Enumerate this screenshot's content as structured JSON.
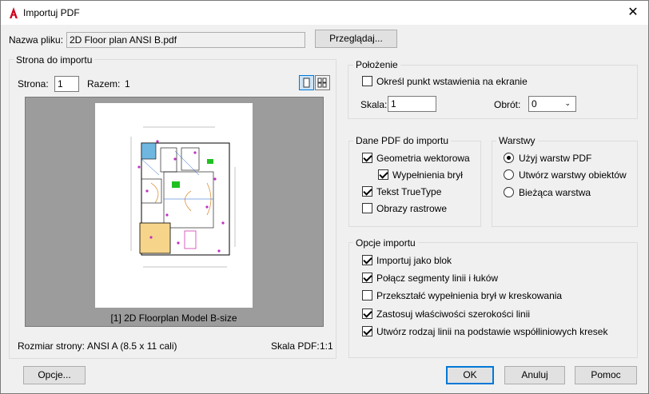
{
  "window": {
    "title": "Importuj PDF",
    "close_glyph": "✕"
  },
  "file": {
    "label": "Nazwa pliku:",
    "value": "2D Floor plan ANSI B.pdf",
    "browse_label": "Przeglądaj..."
  },
  "page_section": {
    "title": "Strona do importu",
    "page_label": "Strona:",
    "page_value": "1",
    "total_label": "Razem:",
    "total_value": "1",
    "preview_caption": "[1] 2D Floorplan Model B-size",
    "page_size_label": "Rozmiar strony:",
    "page_size_value": "ANSI A (8.5 x 11 cali)",
    "pdf_scale_label": "Skala PDF:",
    "pdf_scale_value": "1:1"
  },
  "position": {
    "title": "Położenie",
    "specify_label": "Określ punkt wstawienia na ekranie",
    "specify_checked": false,
    "scale_label": "Skala:",
    "scale_value": "1",
    "rotation_label": "Obrót:",
    "rotation_value": "0"
  },
  "pdf_data": {
    "title": "Dane PDF do importu",
    "items": [
      {
        "label": "Geometria wektorowa",
        "checked": true
      },
      {
        "label": "Wypełnienia brył",
        "checked": true
      },
      {
        "label": "Tekst TrueType",
        "checked": true
      },
      {
        "label": "Obrazy rastrowe",
        "checked": false
      }
    ]
  },
  "layers": {
    "title": "Warstwy",
    "options": [
      {
        "label": "Użyj warstw PDF",
        "selected": true
      },
      {
        "label": "Utwórz warstwy obiektów",
        "selected": false
      },
      {
        "label": "Bieżąca warstwa",
        "selected": false
      }
    ]
  },
  "import_options": {
    "title": "Opcje importu",
    "items": [
      {
        "label": "Importuj jako blok",
        "checked": true
      },
      {
        "label": "Połącz segmenty linii i łuków",
        "checked": true
      },
      {
        "label": "Przekształć wypełnienia brył w kreskowania",
        "checked": false
      },
      {
        "label": "Zastosuj właściwości szerokości linii",
        "checked": true
      },
      {
        "label": "Utwórz rodzaj linii na podstawie współliniowych kresek",
        "checked": true
      }
    ]
  },
  "buttons": {
    "options": "Opcje...",
    "ok": "OK",
    "cancel": "Anuluj",
    "help": "Pomoc"
  }
}
